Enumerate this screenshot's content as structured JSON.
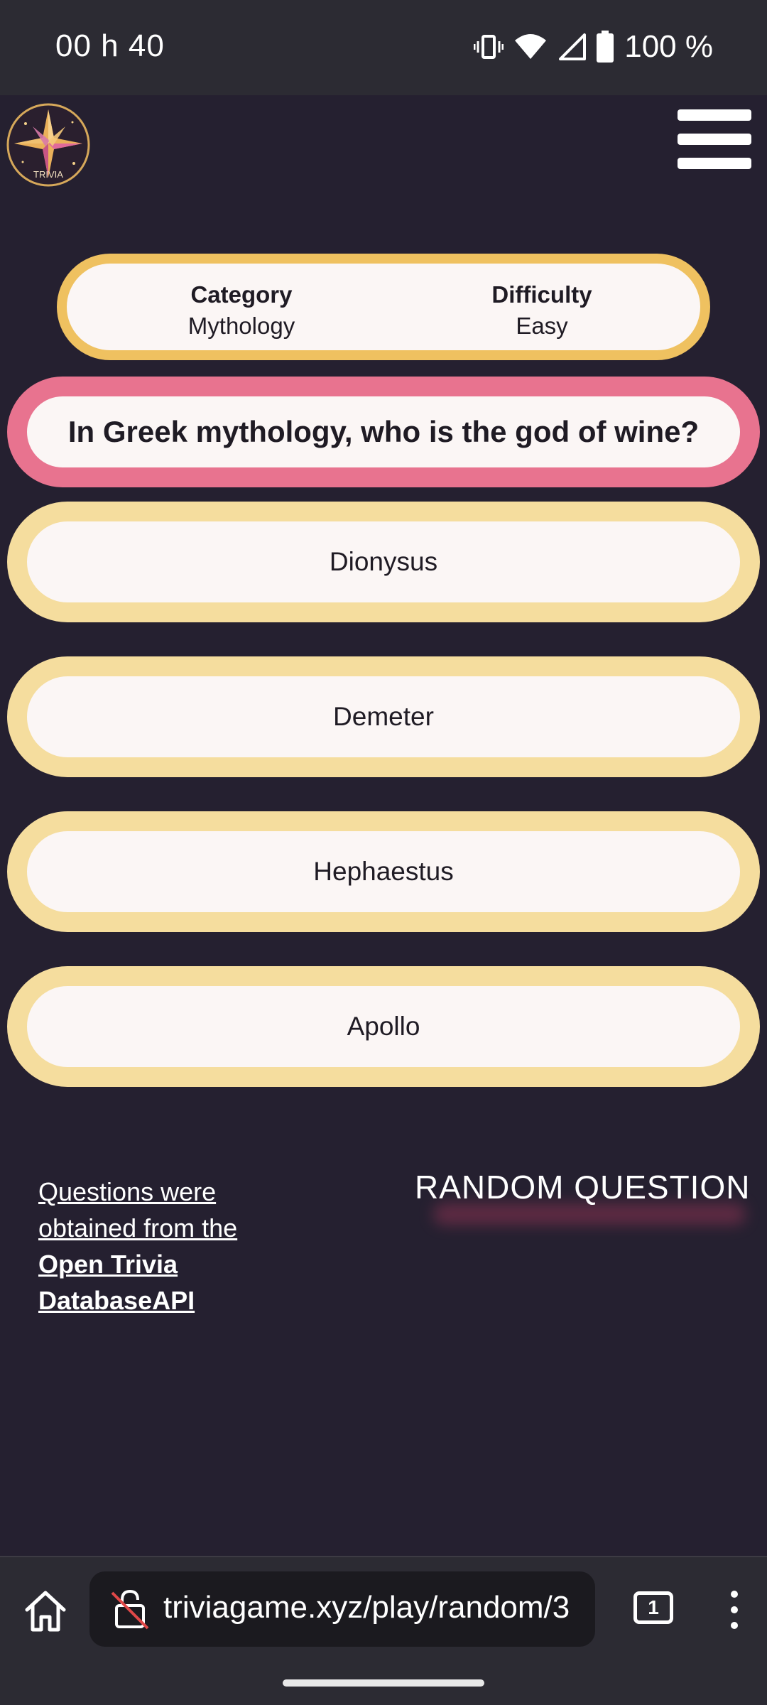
{
  "status_bar": {
    "time": "00 h 40",
    "battery": "100 %",
    "icons": [
      "vibrate-icon",
      "wifi-icon",
      "signal-icon",
      "battery-icon"
    ]
  },
  "header": {
    "logo_text": "TRIVIA",
    "menu_icon": "hamburger-menu-icon"
  },
  "info": {
    "category_label": "Category",
    "category_value": "Mythology",
    "difficulty_label": "Difficulty",
    "difficulty_value": "Easy"
  },
  "question": {
    "text": "In Greek mythology, who is the god of wine?"
  },
  "answers": [
    {
      "label": "Dionysus"
    },
    {
      "label": "Demeter"
    },
    {
      "label": "Hephaestus"
    },
    {
      "label": "Apollo"
    }
  ],
  "footer": {
    "credits_line1": "Questions were",
    "credits_line2": "obtained from the",
    "credits_link1": "Open Trivia",
    "credits_link2": "DatabaseAPI",
    "random_button": "RANDOM QUESTION"
  },
  "browser": {
    "url": "triviagame.xyz/play/random/3",
    "tab_count": "1"
  },
  "colors": {
    "background": "#252030",
    "info_border": "#efc160",
    "question_border": "#e8738f",
    "answer_border": "#f5dd9e",
    "pill_fill": "#fbf6f5"
  }
}
